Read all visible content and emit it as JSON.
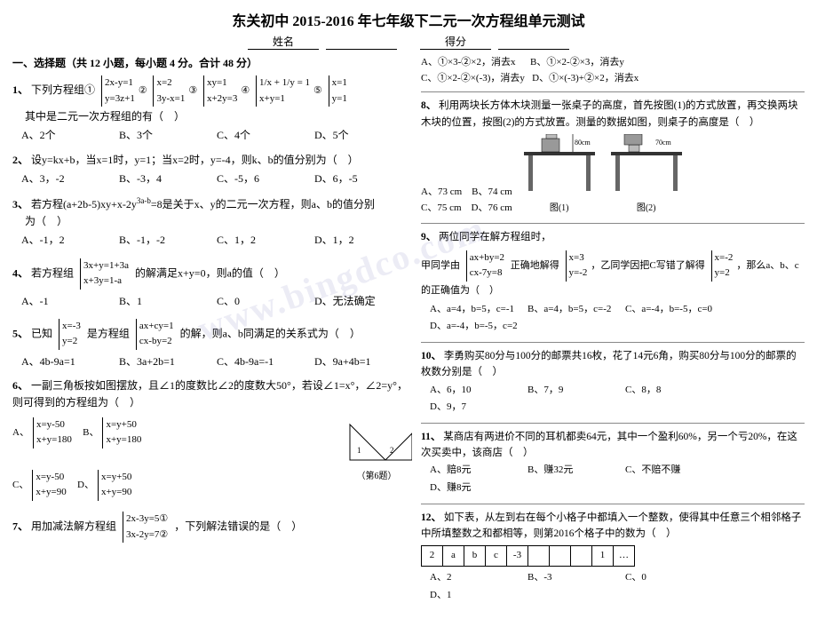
{
  "title": "东关初中 2015-2016 年七年级下二元一次方程组单元测试",
  "name_label": "姓名",
  "score_label": "得分",
  "section1": {
    "title": "一、选择题（共 12 小题，每小题 4 分。合计 48 分）",
    "questions": [
      {
        "num": "1",
        "text": "下列方程组①",
        "sub_text": "其中是二元一次方程组的有（   ）",
        "options": [
          "A、2个",
          "B、3个",
          "C、4个",
          "D、5个"
        ]
      },
      {
        "num": "2",
        "text": "设y=kx+b，当x=1时，y=1；当x=2时，y=-4，则k、b的值分别为（   ）",
        "options": [
          "A、3，-2",
          "B、-3，4",
          "C、-5，6",
          "D、6，-5"
        ]
      },
      {
        "num": "3",
        "text": "若方程(a+2b-5)xy+x-2y^(3a-b)=8是关于x、y的二元一次方程，则a、b的值分别为（   ）",
        "options": [
          "A、-1，2",
          "B、-1，-2",
          "C、1，2",
          "D、1，2"
        ]
      },
      {
        "num": "4",
        "text": "若方程组 {3x+y=1+3a; x+3y=1-a} 的解满足x+y=0，则a的值（   ）",
        "options": [
          "A、-1",
          "B、1",
          "C、0",
          "D、无法确定"
        ]
      },
      {
        "num": "5",
        "text": "已知 {x=-3, 是方程组 {ax+cy=1, 的解，则a、b同满足的关系式为（   ）",
        "sub_text": "           y=2              cx-by=2",
        "options": [
          "A、4b-9a=1",
          "B、3a+2b=1",
          "C、4b-9a=-1",
          "D、9a+4b=1"
        ]
      },
      {
        "num": "6",
        "text": "一副三角板按如图摆放，且∠1的度数比∠2的度数大50°，若设∠1=x°，∠2=y°，则可得到的方程组为（   ）",
        "options": [
          "A、{x=y-50; x+y=180}",
          "B、{x=y+50; x+y=180}",
          "C、{x=y-50; x+y=90}",
          "D、{x=y+50; x+y=90}"
        ]
      },
      {
        "num": "7",
        "text": "用加减法解方程组 {2x-3y=5①; 3x-2y=7②}，下列解法错误的是（   ）"
      }
    ]
  },
  "right_col": {
    "q7_options": [
      "A、①×3-②×2，消去x",
      "B、①×2-②×3，消去y",
      "C、①×2-②×(-3)，消去y",
      "D、①×(-3)+②×2，消去x"
    ],
    "q8": {
      "num": "8",
      "text": "利用两块长方体木块测量一张桌子的高度，首先按图(1)的方式放置，再交换两块木块的位置，按图(2)的方式放置。测量的数据如图，则桌子的高度是（   ）",
      "options": [
        "A、73 cm",
        "B、74 cm",
        "C、75 cm",
        "D、76 cm"
      ],
      "fig1_label": "图(1)",
      "fig2_label": "图(2)",
      "measurement1": "80 cm",
      "measurement2": "70 cm"
    },
    "q9": {
      "num": "9",
      "text": "两位同学在解方程组时，甲同学由 {ax+by=2; cx-7y=8} 正确地解得 {x=3; y=-2}，乙同学因把C写错了解得 {x=-2; y=2}，那么a、b、c的正确值为（   ）",
      "options": [
        "A、a=4，b=5，c=-1",
        "B、a=4，b=5，c=-2",
        "C、a=-4，b=-5，c=0",
        "D、a=-4，b=-5，c=2"
      ]
    },
    "q10": {
      "num": "10",
      "text": "李勇购买80分与100分的邮票共16枚，花了14元6角，购买80分与100分的邮票的枚数分别是（   ）",
      "options": [
        "A、6，10",
        "B、7，9",
        "C、8，8",
        "D、9，7"
      ]
    },
    "q11": {
      "num": "11",
      "text": "某商店有两进价不同的耳机都卖64元，其中一个盈利60%，另一个亏20%，在这次买卖中，该商店（   ）",
      "options": [
        "A、赔8元",
        "B、赚32元",
        "C、不赔不赚",
        "D、赚8元"
      ]
    },
    "q12": {
      "num": "12",
      "text": "如下表，从左到右在每个小格子中都填入一个整数，使得其中任意三个相邻格子中所填整数之和都相等，则第2016个格子中的数为（   ）",
      "table_values": [
        "2",
        "a",
        "b",
        "c",
        "-3",
        "",
        "",
        "",
        "1",
        "…"
      ],
      "options": [
        "A、2",
        "B、-3",
        "C、0",
        "D、1"
      ]
    }
  },
  "watermark": "www.bingdco.com"
}
